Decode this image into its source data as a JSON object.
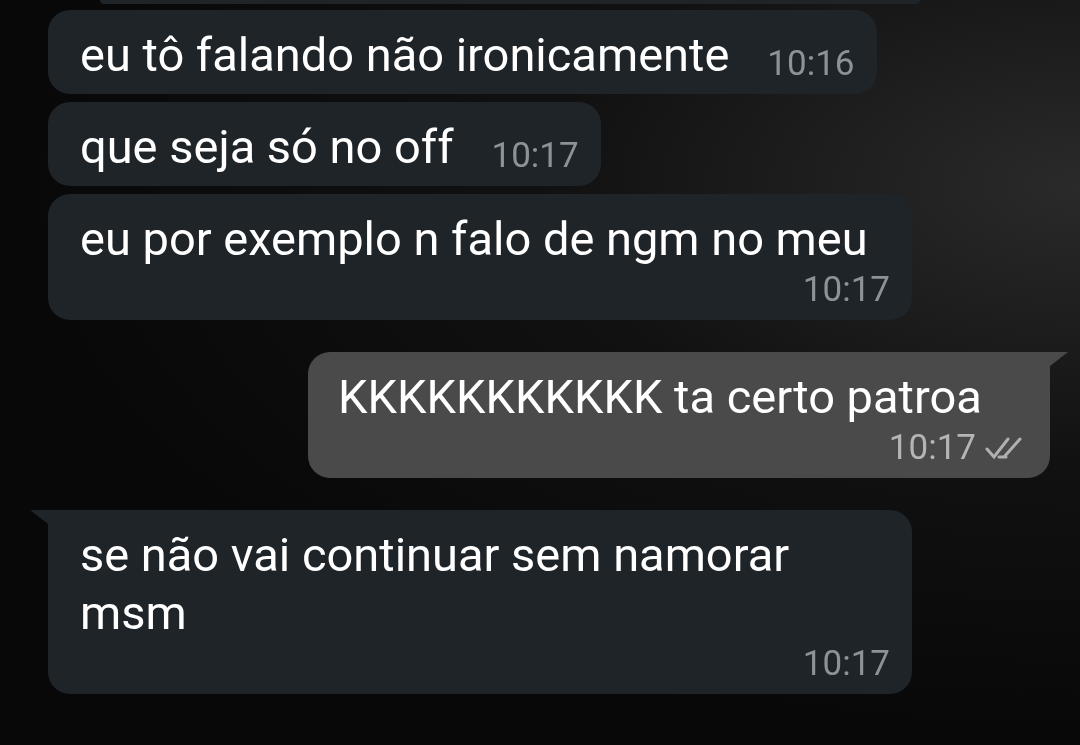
{
  "messages": [
    {
      "outgoing": false,
      "tail": false,
      "text": "eu tô falando não ironicamente",
      "time": "10:16"
    },
    {
      "outgoing": false,
      "tail": false,
      "text": "que seja só no off",
      "time": "10:17"
    },
    {
      "outgoing": false,
      "tail": false,
      "text": "eu por exemplo n falo de ngm no meu",
      "time": "10:17"
    },
    {
      "outgoing": true,
      "tail": true,
      "text": "KKKKKKKKKKK ta certo patroa",
      "time": "10:17",
      "delivered": true
    },
    {
      "outgoing": false,
      "tail": true,
      "text": "se não vai continuar sem namorar msm",
      "time": "10:17"
    }
  ]
}
